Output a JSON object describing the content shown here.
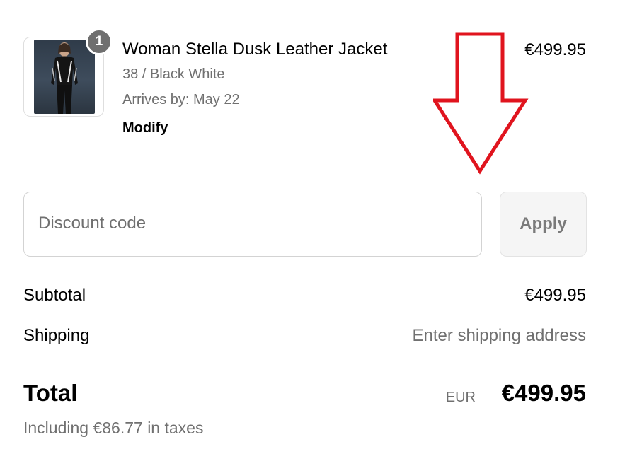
{
  "cart_item": {
    "quantity": "1",
    "title": "Woman Stella Dusk Leather Jacket",
    "variant": "38 / Black White",
    "arrives": "Arrives by: May 22",
    "modify_label": "Modify",
    "price": "€499.95"
  },
  "discount": {
    "placeholder": "Discount code",
    "value": "",
    "apply_label": "Apply"
  },
  "summary": {
    "subtotal_label": "Subtotal",
    "subtotal_value": "€499.95",
    "shipping_label": "Shipping",
    "shipping_value": "Enter shipping address",
    "total_label": "Total",
    "currency": "EUR",
    "total_value": "€499.95",
    "taxes_note": "Including €86.77 in taxes"
  },
  "annotation": {
    "arrow_direction": "down",
    "arrow_color": "#e0141e"
  },
  "colors": {
    "muted_text": "#707070",
    "badge": "#6f6f6f",
    "apply_button_bg": "#f5f5f5"
  }
}
